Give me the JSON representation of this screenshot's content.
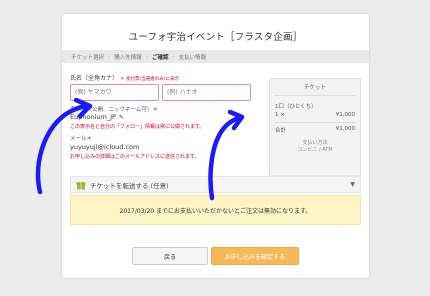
{
  "page_title": "ユーフォ宇治イベント［フラスタ企画］",
  "steps": {
    "items": [
      "チケット選択",
      "購入先情報",
      "ご確認",
      "支払い情報"
    ],
    "separator": "›",
    "current_index": 2
  },
  "form": {
    "name_label": "氏名（全角カナ）",
    "name_required": "＊ 受付票(当選者のみ)に表示",
    "last_name_placeholder": "(例) ヤマカワ",
    "first_name_placeholder": "(例) ハナオ",
    "display_label": "表示名（公開、ニックネーム可）＊",
    "display_value": "Euphonium_JP",
    "display_note": "この表示名と自分の「フォロー」情報は常に公開されます。",
    "mail_label": "メール＊",
    "mail_value": "yuyuyuji@icloud.com",
    "mail_note": "お申し込みの詳細はこのメールアドレスに送信されます。"
  },
  "summary": {
    "title": "チケット",
    "item_name": "1口（ひとくち）",
    "qty": "1 ×",
    "price": "¥1,000",
    "total_label": "合計",
    "total": "¥1,000",
    "pay_label": "支払い方法",
    "pay_method": "コンビニ / ATM"
  },
  "transfer": {
    "label": "チケットを転送する (任意)"
  },
  "notice": {
    "text": "2017/03/20 までにお支払いいただかないとご注文は無効になります。"
  },
  "buttons": {
    "back": "戻る",
    "submit": "お申し込みを確定する"
  },
  "colors": {
    "accent": "#f5b95a",
    "error": "#d0021b",
    "input_border": "#e58ab0",
    "notice_bg": "#fdf4c6",
    "arrow": "#1a1aff"
  }
}
